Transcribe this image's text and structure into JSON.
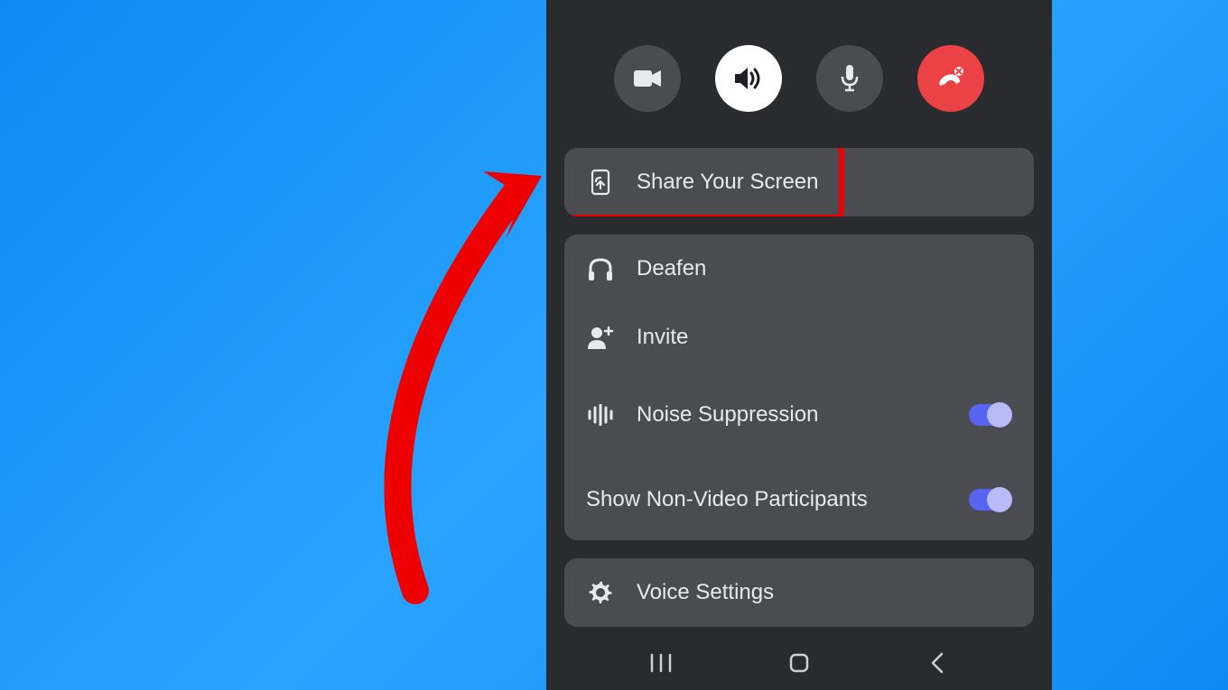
{
  "call_controls": {
    "video_label": "video",
    "speaker_label": "speaker",
    "mic_label": "microphone",
    "hangup_label": "hang-up"
  },
  "share_screen": {
    "label": "Share Your Screen"
  },
  "audio_panel": {
    "deafen_label": "Deafen",
    "invite_label": "Invite",
    "noise_label": "Noise Suppression",
    "noise_on": true,
    "nonvideo_label": "Show Non-Video Participants",
    "nonvideo_on": true
  },
  "voice_settings": {
    "label": "Voice Settings"
  },
  "colors": {
    "highlight": "#ef0000",
    "toggle_on": "#5865f2",
    "hangup": "#ed4245"
  }
}
